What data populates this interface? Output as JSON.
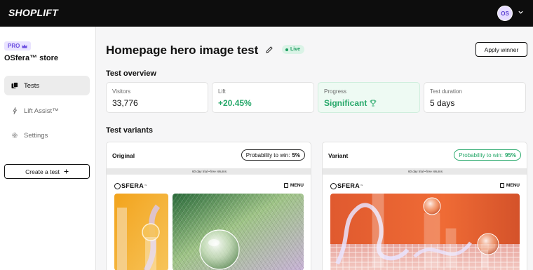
{
  "app": {
    "logo": "SHOPLIFT",
    "avatar_initials": "OS"
  },
  "sidebar": {
    "badge": "PRO",
    "store_name": "OSfera™ store",
    "nav": [
      {
        "label": "Tests",
        "icon": "tests-icon",
        "active": true
      },
      {
        "label": "Lift Assist™",
        "icon": "sparkle-icon",
        "active": false
      },
      {
        "label": "Settings",
        "icon": "gear-icon",
        "active": false
      }
    ],
    "create_label": "Create a test",
    "create_icon": "plus-icon"
  },
  "header": {
    "title": "Homepage hero image test",
    "status": "Live",
    "apply_label": "Apply winner"
  },
  "overview": {
    "title": "Test overview",
    "stats": [
      {
        "label": "Visitors",
        "value": "33,776"
      },
      {
        "label": "Lift",
        "value": "+20.45%"
      },
      {
        "label": "Progress",
        "value": "Significant",
        "icon": "trophy-icon"
      },
      {
        "label": "Test duration",
        "value": "5 days"
      }
    ]
  },
  "variants": {
    "title": "Test variants",
    "items": [
      {
        "name": "Original",
        "prob_label": "Probability to win:",
        "prob_value": "5%",
        "preview": {
          "promo": "60 day trial • free returns",
          "brand": "SFERA",
          "tm": "™",
          "menu": "MENU"
        }
      },
      {
        "name": "Variant",
        "prob_label": "Probability to win:",
        "prob_value": "95%",
        "preview": {
          "promo": "60 day trial • free returns",
          "brand": "SFERA",
          "tm": "™",
          "menu": "MENU"
        }
      }
    ]
  },
  "colors": {
    "accent_green": "#27a86a",
    "pro_purple": "#6b4ee0",
    "topbar": "#0d0d0d"
  }
}
